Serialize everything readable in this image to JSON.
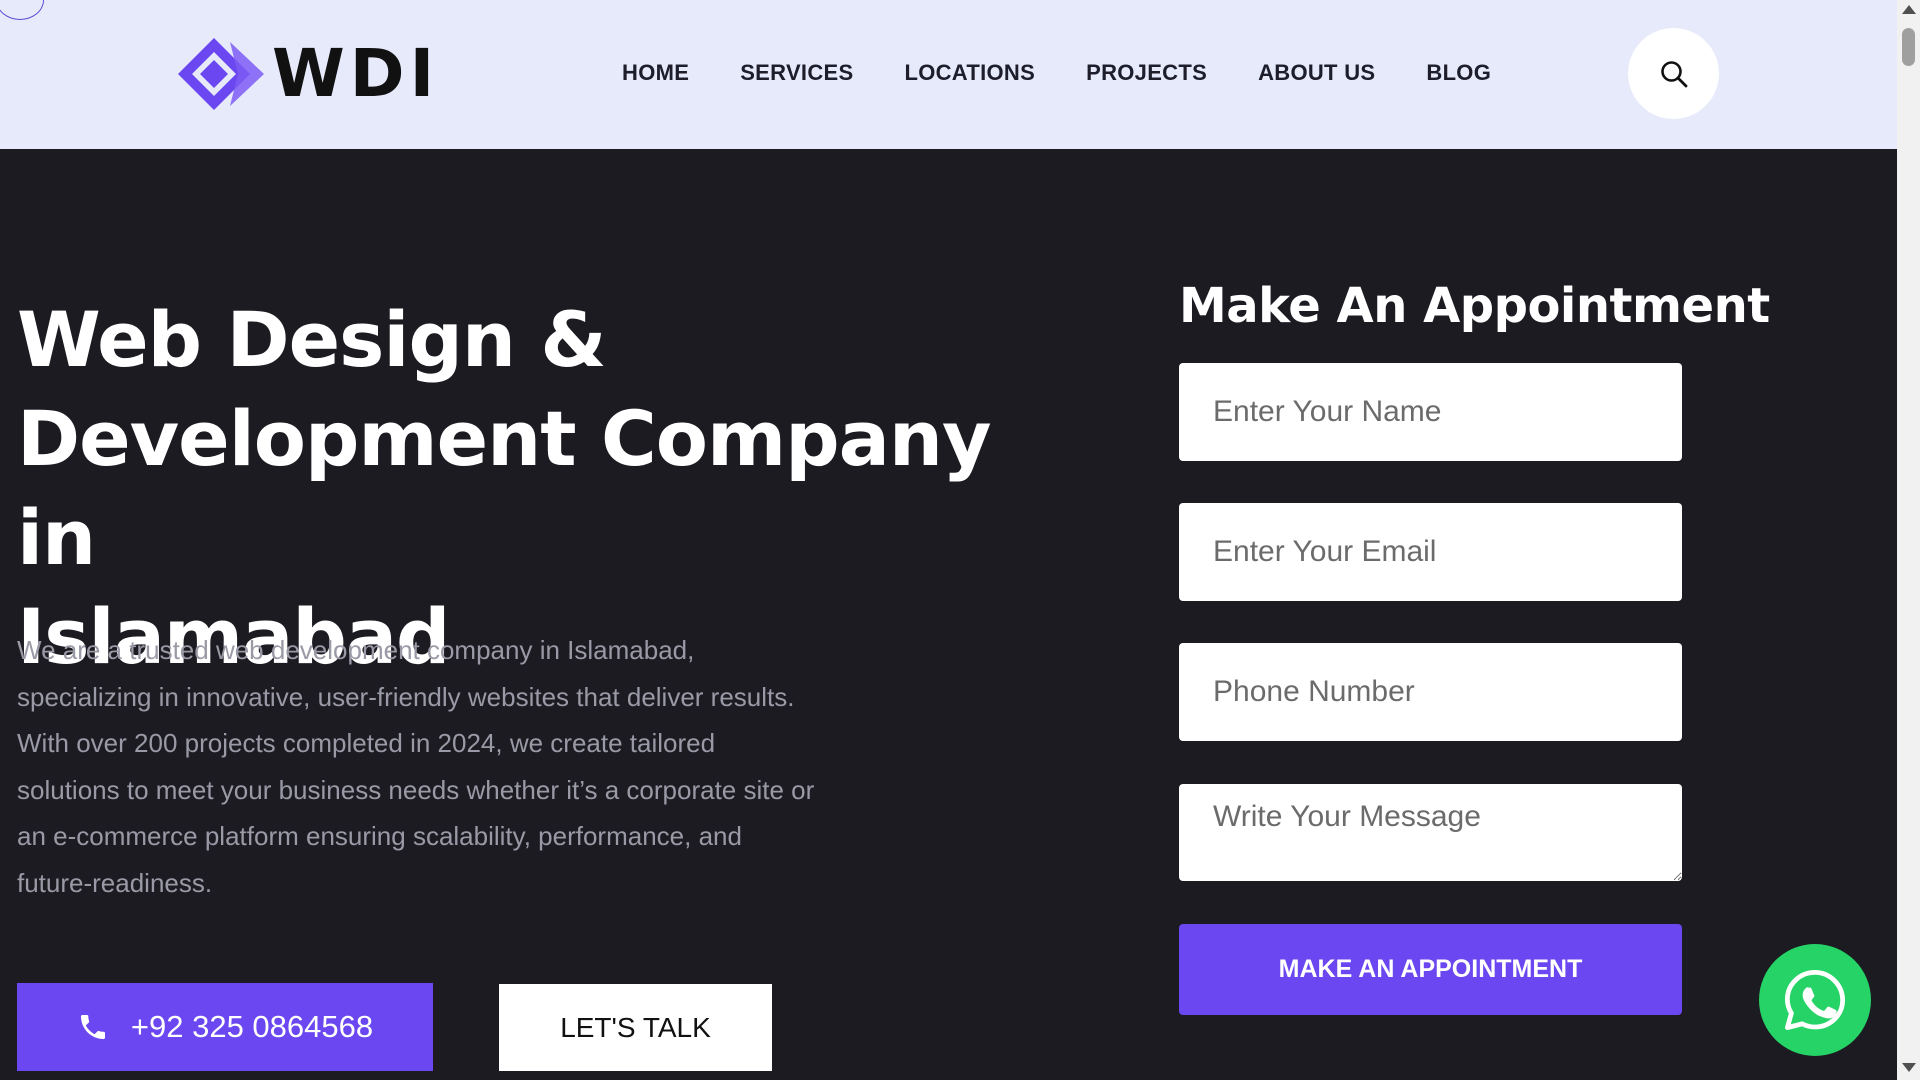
{
  "header": {
    "logo_text": "WDI",
    "nav": [
      {
        "label": "HOME"
      },
      {
        "label": "SERVICES"
      },
      {
        "label": "LOCATIONS"
      },
      {
        "label": "PROJECTS"
      },
      {
        "label": "ABOUT US"
      },
      {
        "label": "BLOG"
      }
    ],
    "search_icon": "search-icon"
  },
  "hero": {
    "title_line1": "Web Design &",
    "title_line2": "Development Company in",
    "title_line3": "Islamabad",
    "description": "We are a trusted web development company in Islamabad, specializing in innovative, user-friendly websites that deliver results. With over 200 projects completed in 2024, we create tailored solutions to meet your business needs whether it’s a corporate site or an e-commerce platform ensuring scalability, performance, and future-readiness.",
    "phone_button": "+92 325 0864568",
    "talk_button": "LET'S TALK"
  },
  "form": {
    "title": "Make An Appointment",
    "name_placeholder": "Enter Your Name",
    "email_placeholder": "Enter Your Email",
    "phone_placeholder": "Phone Number",
    "message_placeholder": "Write Your Message",
    "submit_label": "MAKE AN APPOINTMENT"
  },
  "colors": {
    "accent": "#6a47f0",
    "header_bg": "#e6eafb",
    "page_bg": "#1c1b22",
    "whatsapp": "#25d366"
  },
  "icons": {
    "phone": "phone-icon",
    "whatsapp": "whatsapp-icon"
  }
}
